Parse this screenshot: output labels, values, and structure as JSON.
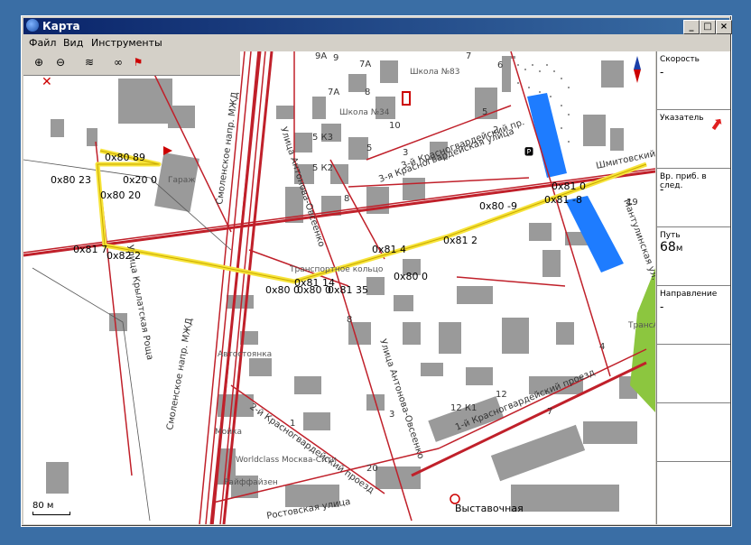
{
  "window": {
    "title": "Карта",
    "buttons": {
      "minimize": "_",
      "maximize": "□",
      "close": "×"
    }
  },
  "menu": [
    "Файл",
    "Вид",
    "Инструменты"
  ],
  "toolbar": {
    "tools": [
      "zoom-in-icon",
      "zoom-out-icon",
      "track-icon",
      "route-icon",
      "flag-icon",
      "cross-icon"
    ]
  },
  "side_panel": {
    "panels": [
      {
        "title": "Скорость",
        "value": "-"
      },
      {
        "title": "Указатель",
        "value": ""
      },
      {
        "title": "Вр. приб. в след.",
        "value": "-"
      },
      {
        "title": "Путь",
        "value": "68",
        "unit": "м"
      },
      {
        "title": "Направление",
        "value": "-"
      }
    ]
  },
  "map": {
    "scale_label": "80 м",
    "streets": [
      "Смоленское напр. МЖД",
      "Смоленское напр. МЖД",
      "Улица Антонова-Овсеенко",
      "Улица Антонова-Овсеенко",
      "3-й Красногвардейский пр.",
      "3-я Красногвардейская улица",
      "1-й Красногвардейский проезд",
      "2-й Красногвардейский проезд",
      "Шмитовский",
      "Мантулинская ул.",
      "Ростовская улица",
      "Улица Крылатская Роща"
    ],
    "places": [
      "Школа №83",
      "Школа №34",
      "Гараж",
      "Автостоянка",
      "Мойка",
      "Worldclass Москва-Сити",
      "Райффайзен",
      "Выставочная",
      "ТрансА",
      "Транспортное кольцо"
    ],
    "house_numbers": [
      "9А",
      "9",
      "7А",
      "7",
      "6",
      "7А",
      "8",
      "5",
      "10",
      "5 К3",
      "5 К2",
      "3",
      "2",
      "5",
      "19",
      "4",
      "12",
      "12 К1",
      "7",
      "3",
      "1",
      "20",
      "8",
      "8"
    ],
    "node_labels": [
      "0x80 89",
      "0x20 0",
      "0x80 23",
      "0x80 20",
      "0x81 7",
      "0x82 2",
      "0x80 0",
      "0x81 4",
      "0x81 2",
      "0x80 -9",
      "0x81 -8",
      "0x81 0",
      "0x80 0",
      "0x80 0",
      "0x81 35",
      "0x81 14"
    ],
    "colors": {
      "road": "#c0202a",
      "route": "#f7e43a",
      "water": "#1e7cff",
      "park": "#8cc63f",
      "building": "#9a9a9a",
      "rail": "#cc0000"
    }
  }
}
